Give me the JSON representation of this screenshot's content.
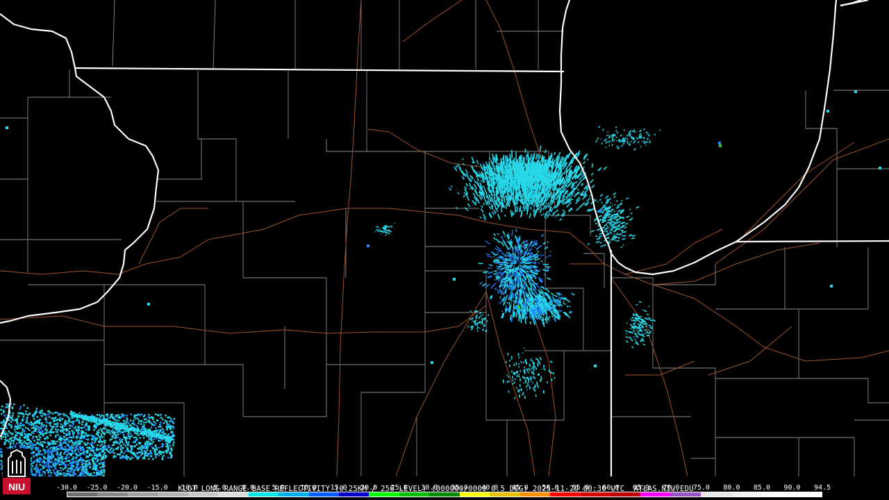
{
  "product": {
    "radar_site": "KLOT",
    "caption": "KLOT LONG RANGE BASE REFLECTIVITY (0.25KM / 256 LEVEL) (000000/0000 0.5 DEG) 2025-11-20 00:30 UTC  ATLAS.NIU.EDU"
  },
  "logo": {
    "text": "NIU",
    "color": "#c8102e"
  },
  "legend": {
    "labels": [
      "-30.0",
      "-25.0",
      "-20.0",
      "-15.0",
      "-10.0",
      "-5.0",
      "0.0",
      "5.0",
      "10.0",
      "15.0",
      "20.0",
      "25.0",
      "30.0",
      "35.0",
      "40.0",
      "45.0",
      "50.0",
      "55.0",
      "60.0",
      "65.0",
      "70.0",
      "75.0",
      "80.0",
      "85.0",
      "90.0",
      "94.5"
    ],
    "colors": [
      "#6e6e6e",
      "#8a8a8a",
      "#a0a0a0",
      "#b4b4b4",
      "#c8c8c8",
      "#dcdcdc",
      "#00e8e8",
      "#00b0f0",
      "#0060ff",
      "#0000c8",
      "#00ff00",
      "#00c000",
      "#008c00",
      "#ffff00",
      "#e8c000",
      "#ff9000",
      "#ff0000",
      "#d40000",
      "#c00000",
      "#ff00ff",
      "#9955c9",
      "#e6e6e6",
      "#f2f2f2",
      "#ffffff",
      "#ffffff"
    ]
  },
  "colors": {
    "state_lines": "#ffffff",
    "county_lines": "#8c8c8c",
    "roads": "#a0522d",
    "echo_light": "#28d8e8",
    "echo_medium": "#1e8cff",
    "echo_dark": "#2060c8",
    "echo_green": "#32c832"
  }
}
